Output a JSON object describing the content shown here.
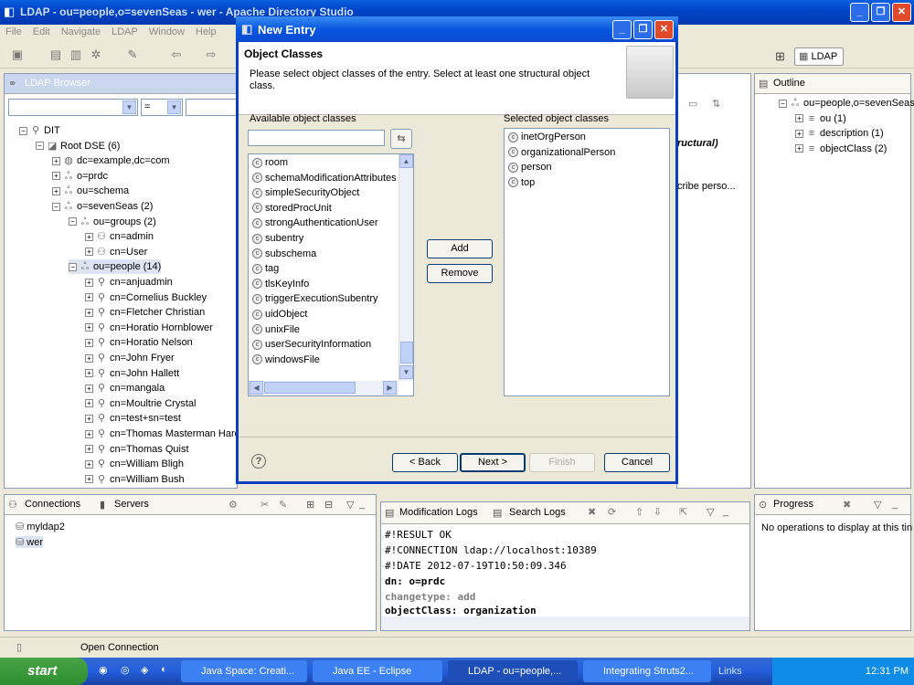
{
  "window": {
    "title": "LDAP - ou=people,o=sevenSeas - wer - Apache Directory Studio"
  },
  "menu": [
    "File",
    "Edit",
    "Navigate",
    "LDAP",
    "Window",
    "Help"
  ],
  "perspective": {
    "label": "LDAP"
  },
  "browser": {
    "tab": "LDAP Browser",
    "op": "=",
    "tree": [
      {
        "label": "DIT",
        "depth": 0,
        "pm": "−",
        "icon": "dit-icon"
      },
      {
        "label": "Root DSE (6)",
        "depth": 1,
        "pm": "−",
        "icon": "root-icon"
      },
      {
        "label": "dc=example,dc=com",
        "depth": 2,
        "pm": "+",
        "icon": "globe-icon"
      },
      {
        "label": "o=prdc",
        "depth": 2,
        "pm": "+",
        "icon": "org-icon"
      },
      {
        "label": "ou=schema",
        "depth": 2,
        "pm": "+",
        "icon": "org-icon"
      },
      {
        "label": "o=sevenSeas (2)",
        "depth": 2,
        "pm": "−",
        "icon": "org-icon"
      },
      {
        "label": "ou=groups (2)",
        "depth": 3,
        "pm": "−",
        "icon": "org-icon"
      },
      {
        "label": "cn=admin",
        "depth": 4,
        "pm": "+",
        "icon": "group-icon"
      },
      {
        "label": "cn=User",
        "depth": 4,
        "pm": "+",
        "icon": "group-icon"
      },
      {
        "label": "ou=people (14)",
        "depth": 3,
        "pm": "−",
        "icon": "org-icon"
      },
      {
        "label": "cn=anjuadmin",
        "depth": 4,
        "pm": "+",
        "icon": "person-icon"
      },
      {
        "label": "cn=Cornelius Buckley",
        "depth": 4,
        "pm": "+",
        "icon": "person-icon"
      },
      {
        "label": "cn=Fletcher Christian",
        "depth": 4,
        "pm": "+",
        "icon": "person-icon"
      },
      {
        "label": "cn=Horatio Hornblower",
        "depth": 4,
        "pm": "+",
        "icon": "person-icon"
      },
      {
        "label": "cn=Horatio Nelson",
        "depth": 4,
        "pm": "+",
        "icon": "person-icon"
      },
      {
        "label": "cn=John Fryer",
        "depth": 4,
        "pm": "+",
        "icon": "person-icon"
      },
      {
        "label": "cn=John Hallett",
        "depth": 4,
        "pm": "+",
        "icon": "person-icon"
      },
      {
        "label": "cn=mangala",
        "depth": 4,
        "pm": "+",
        "icon": "person-icon"
      },
      {
        "label": "cn=Moultrie Crystal",
        "depth": 4,
        "pm": "+",
        "icon": "person-icon"
      },
      {
        "label": "cn=test+sn=test",
        "depth": 4,
        "pm": "+",
        "icon": "person-icon"
      },
      {
        "label": "cn=Thomas Masterman Hard",
        "depth": 4,
        "pm": "+",
        "icon": "person-icon"
      },
      {
        "label": "cn=Thomas Quist",
        "depth": 4,
        "pm": "+",
        "icon": "person-icon"
      },
      {
        "label": "cn=William Bligh",
        "depth": 4,
        "pm": "+",
        "icon": "person-icon"
      },
      {
        "label": "cn=William Bush",
        "depth": 4,
        "pm": "+",
        "icon": "person-icon"
      }
    ]
  },
  "editor": {
    "frag1": "ructural)",
    "frag2": "cribe perso..."
  },
  "outline": {
    "tab": "Outline",
    "items": [
      {
        "label": "ou=people,o=sevenSeas",
        "depth": 0,
        "pm": "−"
      },
      {
        "label": "ou (1)",
        "depth": 1,
        "pm": "+"
      },
      {
        "label": "description (1)",
        "depth": 1,
        "pm": "+"
      },
      {
        "label": "objectClass (2)",
        "depth": 1,
        "pm": "+"
      }
    ]
  },
  "connections": {
    "tab1": "Connections",
    "tab2": "Servers",
    "items": [
      "myldap2",
      "wer"
    ]
  },
  "logs": {
    "tab1": "Modification Logs",
    "tab2": "Search Logs",
    "lines": [
      "#!RESULT OK",
      "#!CONNECTION ldap://localhost:10389",
      "#!DATE 2012-07-19T10:50:09.346",
      "dn: o=prdc",
      "changetype: add",
      "objectClass: organization"
    ]
  },
  "progress": {
    "tab": "Progress",
    "message": "No operations to display at this tin"
  },
  "status": {
    "text": "Open Connection"
  },
  "dialog": {
    "title": "New Entry",
    "heading": "Object Classes",
    "description": "Please select object classes of the entry. Select at least one structural object class.",
    "available_label": "Available object classes",
    "selected_label": "Selected object classes",
    "filter_value": "",
    "available": [
      "room",
      "schemaModificationAttributes",
      "simpleSecurityObject",
      "storedProcUnit",
      "strongAuthenticationUser",
      "subentry",
      "subschema",
      "tag",
      "tlsKeyInfo",
      "triggerExecutionSubentry",
      "uidObject",
      "unixFile",
      "userSecurityInformation",
      "windowsFile"
    ],
    "selected": [
      "inetOrgPerson",
      "organizationalPerson",
      "person",
      "top"
    ],
    "add": "Add",
    "remove": "Remove",
    "back": "< Back",
    "next": "Next >",
    "finish": "Finish",
    "cancel": "Cancel"
  },
  "taskbar": {
    "start": "start",
    "tasks": [
      "Java Space: Creati...",
      "Java EE - Eclipse",
      "LDAP - ou=people,...",
      "Integrating Struts2..."
    ],
    "links": "Links",
    "clock": "12:31 PM"
  },
  "colors": {
    "xp_blue": "#0a5fe0",
    "selection": "#dde4f2",
    "ldif_keyword": "#7f7f7f"
  }
}
